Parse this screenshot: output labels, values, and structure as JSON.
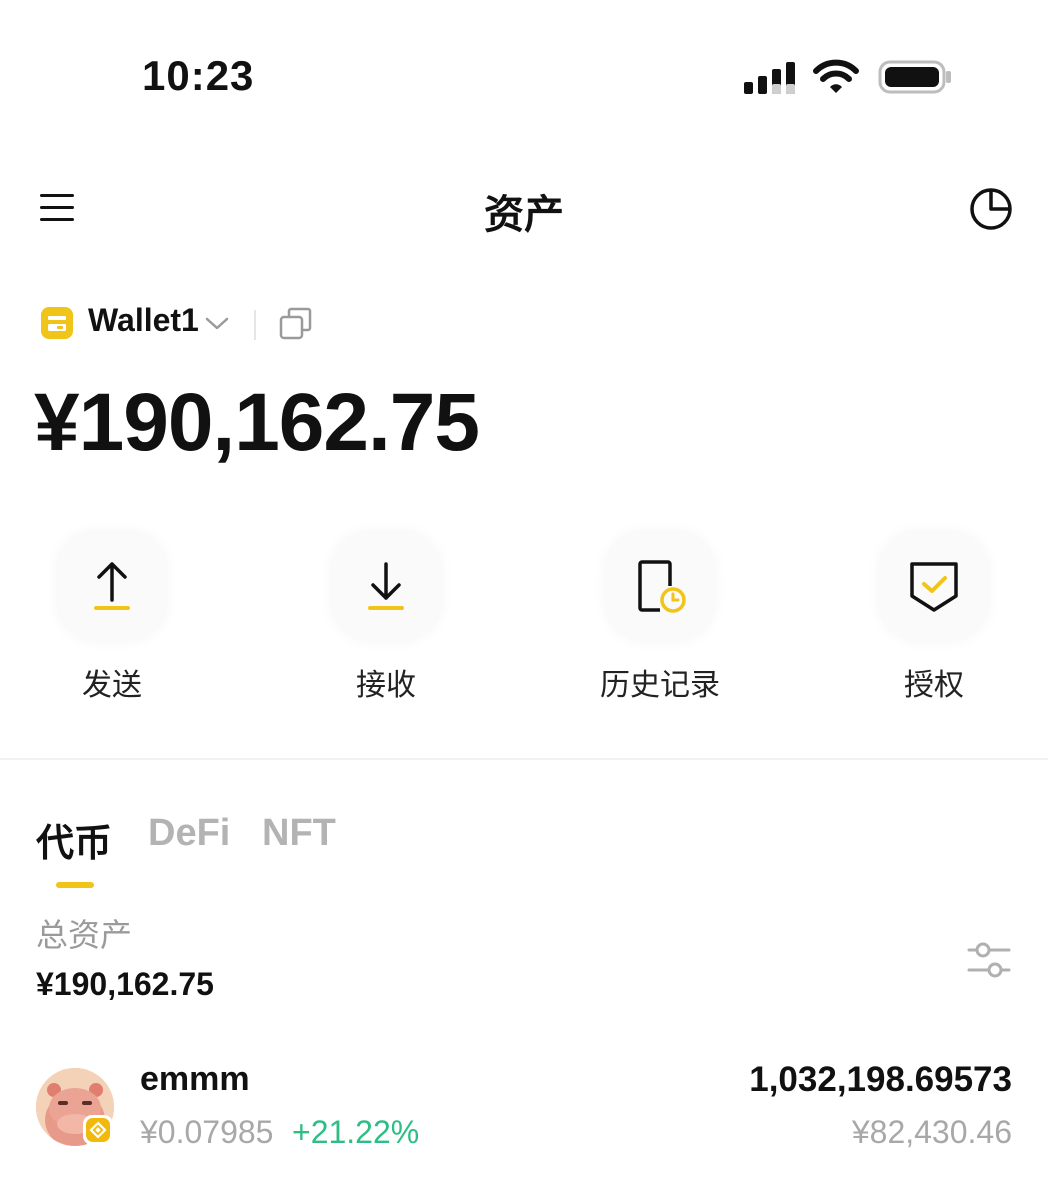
{
  "status_bar": {
    "time": "10:23"
  },
  "header": {
    "title": "资产"
  },
  "wallet": {
    "name": "Wallet1",
    "balance": "¥190,162.75"
  },
  "actions": [
    {
      "label": "发送",
      "icon": "send-arrow-up-icon"
    },
    {
      "label": "接收",
      "icon": "receive-arrow-down-icon"
    },
    {
      "label": "历史记录",
      "icon": "history-clock-icon"
    },
    {
      "label": "授权",
      "icon": "approval-check-icon"
    }
  ],
  "tabs": [
    {
      "label": "代币",
      "active": true
    },
    {
      "label": "DeFi",
      "active": false
    },
    {
      "label": "NFT",
      "active": false
    }
  ],
  "summary": {
    "label": "总资产",
    "value": "¥190,162.75"
  },
  "tokens": [
    {
      "name": "emmm",
      "price": "¥0.07985",
      "change": "+21.22%",
      "amount": "1,032,198.69573",
      "value": "¥82,430.46"
    }
  ],
  "colors": {
    "accent": "#f0c419",
    "positive": "#2ebd85",
    "muted": "#a8a8a8"
  }
}
